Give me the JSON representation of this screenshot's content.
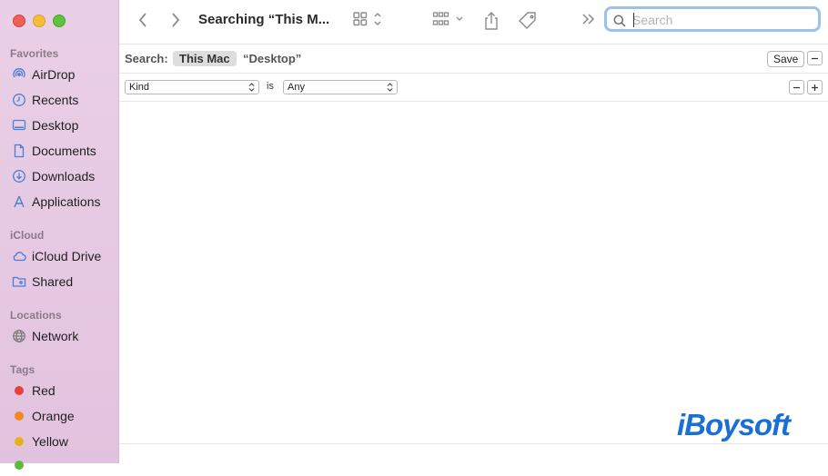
{
  "window": {
    "title": "Searching “This M..."
  },
  "sidebar": {
    "favorites_label": "Favorites",
    "favorites": [
      {
        "label": "AirDrop",
        "icon": "airdrop-icon"
      },
      {
        "label": "Recents",
        "icon": "clock-icon"
      },
      {
        "label": "Desktop",
        "icon": "desktop-icon"
      },
      {
        "label": "Documents",
        "icon": "document-icon"
      },
      {
        "label": "Downloads",
        "icon": "download-icon"
      },
      {
        "label": "Applications",
        "icon": "applications-icon"
      }
    ],
    "icloud_label": "iCloud",
    "icloud": [
      {
        "label": "iCloud Drive",
        "icon": "cloud-icon"
      },
      {
        "label": "Shared",
        "icon": "shared-folder-icon"
      }
    ],
    "locations_label": "Locations",
    "locations": [
      {
        "label": "Network",
        "icon": "globe-icon"
      }
    ],
    "tags_label": "Tags",
    "tags": [
      {
        "label": "Red",
        "color": "#e8413c"
      },
      {
        "label": "Orange",
        "color": "#ef8a1f"
      },
      {
        "label": "Yellow",
        "color": "#e3b319"
      }
    ]
  },
  "search": {
    "placeholder": "Search",
    "value": ""
  },
  "scopebar": {
    "label": "Search:",
    "active_scope": "This Mac",
    "other_scope": "“Desktop”",
    "save_label": "Save"
  },
  "criteria": {
    "attribute": "Kind",
    "operator": "is",
    "value": "Any"
  },
  "watermark": {
    "text": "iBoysoft"
  },
  "colors": {
    "accent": "#1a6fd6",
    "search_focus": "#9dc0ee",
    "sidebar_icon": "#4a7fd4"
  }
}
